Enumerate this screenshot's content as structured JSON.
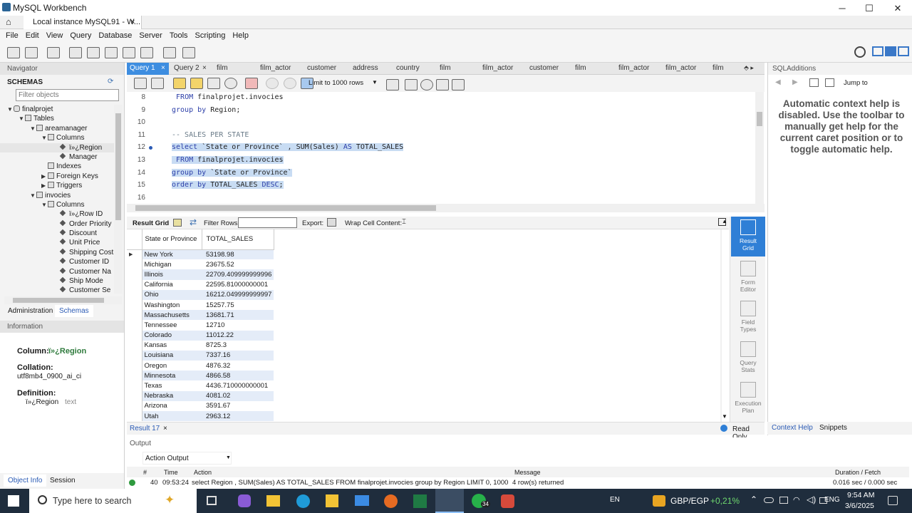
{
  "window": {
    "title": "MySQL Workbench",
    "tab": "Local instance MySQL91 - W...",
    "minimize": "─",
    "maximize": "☐",
    "close": "✕"
  },
  "menu": [
    "File",
    "Edit",
    "View",
    "Query",
    "Database",
    "Server",
    "Tools",
    "Scripting",
    "Help"
  ],
  "navigator": {
    "header": "Navigator",
    "schemas_label": "SCHEMAS",
    "filter_placeholder": "Filter objects",
    "tree": [
      {
        "label": "finalprojet",
        "level": 0,
        "icon": "db",
        "arrow": "▼"
      },
      {
        "label": "Tables",
        "level": 1,
        "icon": "folder",
        "arrow": "▼"
      },
      {
        "label": "areamanager",
        "level": 2,
        "icon": "table",
        "arrow": "▼"
      },
      {
        "label": "Columns",
        "level": 3,
        "icon": "folder",
        "arrow": "▼"
      },
      {
        "label": "ï»¿Region",
        "level": 4,
        "icon": "column",
        "arrow": "",
        "selected": true
      },
      {
        "label": "Manager",
        "level": 4,
        "icon": "column",
        "arrow": ""
      },
      {
        "label": "Indexes",
        "level": 3,
        "icon": "folder",
        "arrow": ""
      },
      {
        "label": "Foreign Keys",
        "level": 3,
        "icon": "folder",
        "arrow": "▶"
      },
      {
        "label": "Triggers",
        "level": 3,
        "icon": "folder",
        "arrow": "▶"
      },
      {
        "label": "invocies",
        "level": 2,
        "icon": "table",
        "arrow": "▼"
      },
      {
        "label": "Columns",
        "level": 3,
        "icon": "folder",
        "arrow": "▼"
      },
      {
        "label": "ï»¿Row ID",
        "level": 4,
        "icon": "column",
        "arrow": ""
      },
      {
        "label": "Order Priority",
        "level": 4,
        "icon": "column",
        "arrow": ""
      },
      {
        "label": "Discount",
        "level": 4,
        "icon": "column",
        "arrow": ""
      },
      {
        "label": "Unit Price",
        "level": 4,
        "icon": "column",
        "arrow": ""
      },
      {
        "label": "Shipping Cost",
        "level": 4,
        "icon": "column",
        "arrow": ""
      },
      {
        "label": "Customer ID",
        "level": 4,
        "icon": "column",
        "arrow": ""
      },
      {
        "label": "Customer Na",
        "level": 4,
        "icon": "column",
        "arrow": ""
      },
      {
        "label": "Ship Mode",
        "level": 4,
        "icon": "column",
        "arrow": ""
      },
      {
        "label": "Customer Se",
        "level": 4,
        "icon": "column",
        "arrow": ""
      }
    ],
    "tabs": [
      "Administration",
      "Schemas"
    ],
    "info_header": "Information",
    "info": {
      "column_label": "Column:",
      "column_value": "ï»¿Region",
      "collation_label": "Collation:",
      "collation_value": "utf8mb4_0900_ai_ci",
      "definition_label": "Definition:",
      "definition_name": "ï»¿Region",
      "definition_type": "text"
    },
    "bottom_tabs": [
      "Object Info",
      "Session"
    ]
  },
  "query_tabs": [
    "Query 1",
    "Query 2",
    "film",
    "film_actor",
    "customer",
    "address",
    "country",
    "film",
    "film_actor",
    "customer",
    "film",
    "film_actor",
    "film_actor",
    "film"
  ],
  "limit_label": "Limit to 1000 rows",
  "editor": {
    "lines": [
      {
        "n": "8",
        "text": " FROM finalprojet.invocies"
      },
      {
        "n": "9",
        "text": "group by Region;"
      },
      {
        "n": "10",
        "text": ""
      },
      {
        "n": "11",
        "text": "-- SALES PER STATE"
      },
      {
        "n": "12",
        "text": "select `State or Province` , SUM(Sales) AS TOTAL_SALES"
      },
      {
        "n": "13",
        "text": " FROM finalprojet.invocies"
      },
      {
        "n": "14",
        "text": "group by `State or Province`"
      },
      {
        "n": "15",
        "text": "order by TOTAL_SALES DESC;"
      },
      {
        "n": "16",
        "text": ""
      }
    ]
  },
  "result_toolbar": {
    "grid": "Result Grid",
    "filter": "Filter Rows:",
    "export": "Export:",
    "wrap": "Wrap Cell Content:"
  },
  "result": {
    "columns": [
      "State or Province",
      "TOTAL_SALES"
    ],
    "rows": [
      [
        "New York",
        "53198.98"
      ],
      [
        "Michigan",
        "23675.52"
      ],
      [
        "Illinois",
        "22709.409999999996"
      ],
      [
        "California",
        "22595.81000000001"
      ],
      [
        "Ohio",
        "16212.049999999997"
      ],
      [
        "Washington",
        "15257.75"
      ],
      [
        "Massachusetts",
        "13681.71"
      ],
      [
        "Tennessee",
        "12710"
      ],
      [
        "Colorado",
        "11012.22"
      ],
      [
        "Kansas",
        "8725.3"
      ],
      [
        "Louisiana",
        "7337.16"
      ],
      [
        "Oregon",
        "4876.32"
      ],
      [
        "Minnesota",
        "4866.58"
      ],
      [
        "Texas",
        "4436.710000000001"
      ],
      [
        "Nebraska",
        "4081.02"
      ],
      [
        "Arizona",
        "3591.67"
      ],
      [
        "Utah",
        "2963.12"
      ]
    ]
  },
  "side_buttons": [
    "Result Grid",
    "Form Editor",
    "Field Types",
    "Query Stats",
    "Execution Plan"
  ],
  "result_tab": "Result 17",
  "read_only": "Read Only",
  "output": {
    "header": "Output",
    "mode": "Action Output",
    "cols": [
      "#",
      "Time",
      "Action",
      "Message",
      "Duration / Fetch"
    ],
    "row": {
      "num": "40",
      "time": "09:53:24",
      "action": "select Region , SUM(Sales) AS TOTAL_SALES  FROM finalprojet.invocies  group by Region LIMIT 0, 1000",
      "message": "4 row(s) returned",
      "duration": "0.016 sec / 0.000 sec"
    }
  },
  "sql_additions": {
    "header": "SQLAdditions",
    "jump": "Jump to",
    "help": "Automatic context help is disabled. Use the toolbar to manually get help for the current caret position or to toggle automatic help.",
    "tabs": [
      "Context Help",
      "Snippets"
    ]
  },
  "taskbar": {
    "search": "Type here to search",
    "lang": "EN",
    "ticker": "GBP/EGP",
    "change": "+0,21%",
    "eng": "ENG",
    "time": "9:54 AM",
    "date": "3/6/2025",
    "badge": "34"
  }
}
